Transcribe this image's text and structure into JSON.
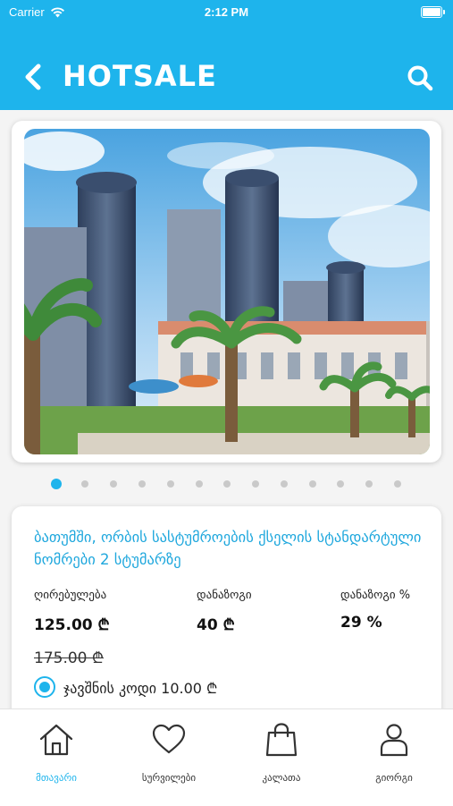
{
  "status_bar": {
    "carrier": "Carrier",
    "time": "2:12 PM"
  },
  "header": {
    "title": "HOTSALE"
  },
  "carousel": {
    "page_count": 13,
    "active_index": 0
  },
  "offer": {
    "title": "ბათუმში, ორბის სასტუმროების ქსელის სტანდარტული ნომრები 2 სტუმარზე",
    "price_label": "ღირებულება",
    "price_value": "125.00 ₾",
    "discount_label": "დანაზოგი",
    "discount_value": "40 ₾",
    "discount_pct_label": "დანაზოგი %",
    "discount_pct_value": "29 %",
    "old_price": "175.00 ₾",
    "booking_code": "ჯავშნის კოდი 10.00 ₾"
  },
  "tabbar": {
    "items": [
      {
        "label": "მთავარი",
        "icon": "home-icon",
        "active": true
      },
      {
        "label": "სურვილები",
        "icon": "heart-icon",
        "active": false
      },
      {
        "label": "კალათა",
        "icon": "bag-icon",
        "active": false
      },
      {
        "label": "გიორგი",
        "icon": "user-icon",
        "active": false
      }
    ]
  },
  "colors": {
    "accent": "#1eb4ec",
    "title_text": "#1ea7dd"
  }
}
